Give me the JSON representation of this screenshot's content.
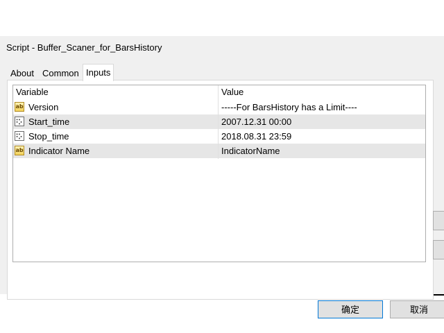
{
  "window": {
    "title": "Script - Buffer_Scaner_for_BarsHistory"
  },
  "tabs": [
    {
      "label": "About"
    },
    {
      "label": "Common"
    },
    {
      "label": "Inputs"
    }
  ],
  "grid": {
    "columns": [
      "Variable",
      "Value"
    ],
    "rows": [
      {
        "icon": "ab-string-icon",
        "name": "Version",
        "value": "-----For BarsHistory has a Limit----"
      },
      {
        "icon": "calendar-icon",
        "name": "Start_time",
        "value": "2007.12.31 00:00"
      },
      {
        "icon": "calendar-icon",
        "name": "Stop_time",
        "value": "2018.08.31 23:59"
      },
      {
        "icon": "ab-string-icon",
        "name": "Indicator Name",
        "value": "IndicatorName"
      }
    ]
  },
  "buttons": {
    "ok_label": "确定",
    "cancel_label": "取消"
  },
  "colors": {
    "dialog_bg": "#f0f0f0",
    "alt_row": "#e6e6e6",
    "ok_border": "#0078d7"
  }
}
